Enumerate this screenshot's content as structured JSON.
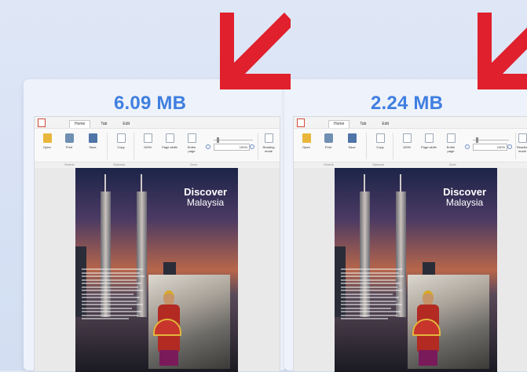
{
  "comparison": {
    "left": {
      "size": "6.09 MB"
    },
    "right": {
      "size": "2.24 MB"
    }
  },
  "viewer": {
    "tabs": [
      "Home",
      "Tab",
      "Edit"
    ],
    "ribbon": {
      "open": "Open",
      "print": "Print",
      "save": "Save",
      "copy": "Copy",
      "zoom_100": "100%",
      "page_width": "Page width",
      "entire_page": "Entire page",
      "zoom_value": "100%",
      "reading_mode": "Reading mode"
    },
    "groups": [
      "General",
      "Clipboard",
      "Zoom"
    ]
  },
  "brochure": {
    "title_line1": "Discover",
    "title_line2": "Malaysia"
  },
  "colors": {
    "accent": "#3f7fe0",
    "arrow": "#e0202c",
    "background": "#d9e3f5"
  }
}
